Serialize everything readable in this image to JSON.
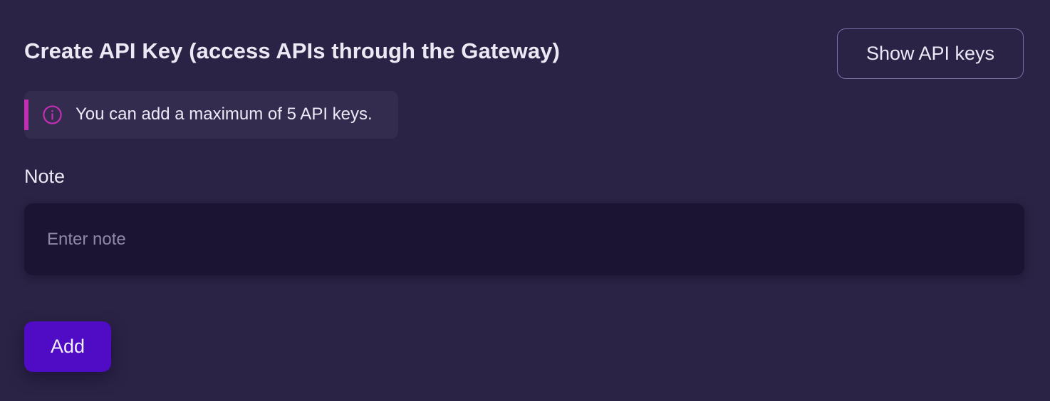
{
  "header": {
    "title": "Create API Key (access APIs through the Gateway)",
    "show_keys_label": "Show API keys"
  },
  "alert": {
    "icon": "info-icon",
    "message": "You can add a maximum of 5 API keys.",
    "accent_color": "#c22fb3"
  },
  "form": {
    "note_label": "Note",
    "note_placeholder": "Enter note",
    "note_value": "",
    "add_label": "Add"
  },
  "colors": {
    "background": "#2b2345",
    "input_background": "#1b1533",
    "primary_button": "#4f0cc4",
    "outline_button_border": "#7e6ea8"
  }
}
